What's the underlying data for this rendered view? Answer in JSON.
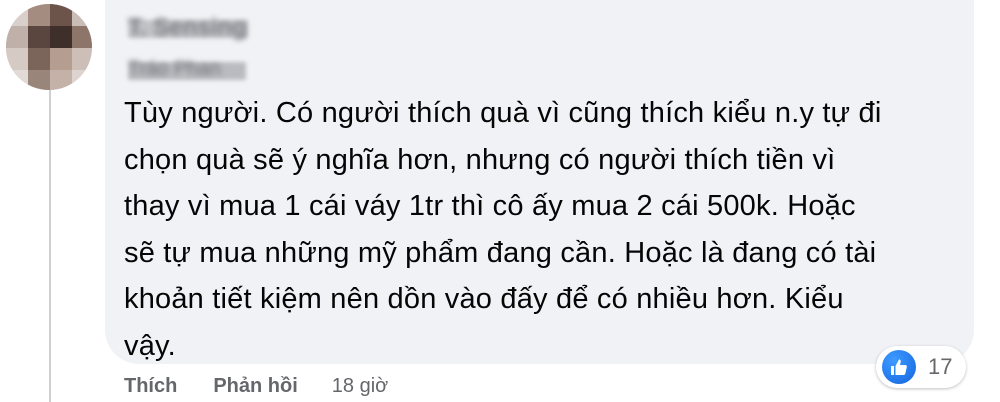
{
  "comment": {
    "author_name": "T. Sensing",
    "author_badge": "Tráo Phan",
    "text_lines": [
      "Tùy người. Có người thích quà vì cũng thích kiểu n.y tự đi",
      "chọn quà sẽ ý nghĩa hơn, nhưng có người thích tiền vì",
      "thay vì mua 1 cái váy 1tr thì cô ấy mua 2 cái 500k. Hoặc",
      "sẽ tự mua những mỹ phẩm đang cần. Hoặc là đang có tài",
      "khoản tiết kiệm nên dồn vào đấy để có nhiều hơn. Kiểu",
      "vậy."
    ],
    "reactions": {
      "icon": "like-thumb-icon",
      "count": "17",
      "color": "#1877f2"
    },
    "actions": {
      "like_label": "Thích",
      "reply_label": "Phản hồi",
      "timestamp": "18 giờ"
    }
  }
}
